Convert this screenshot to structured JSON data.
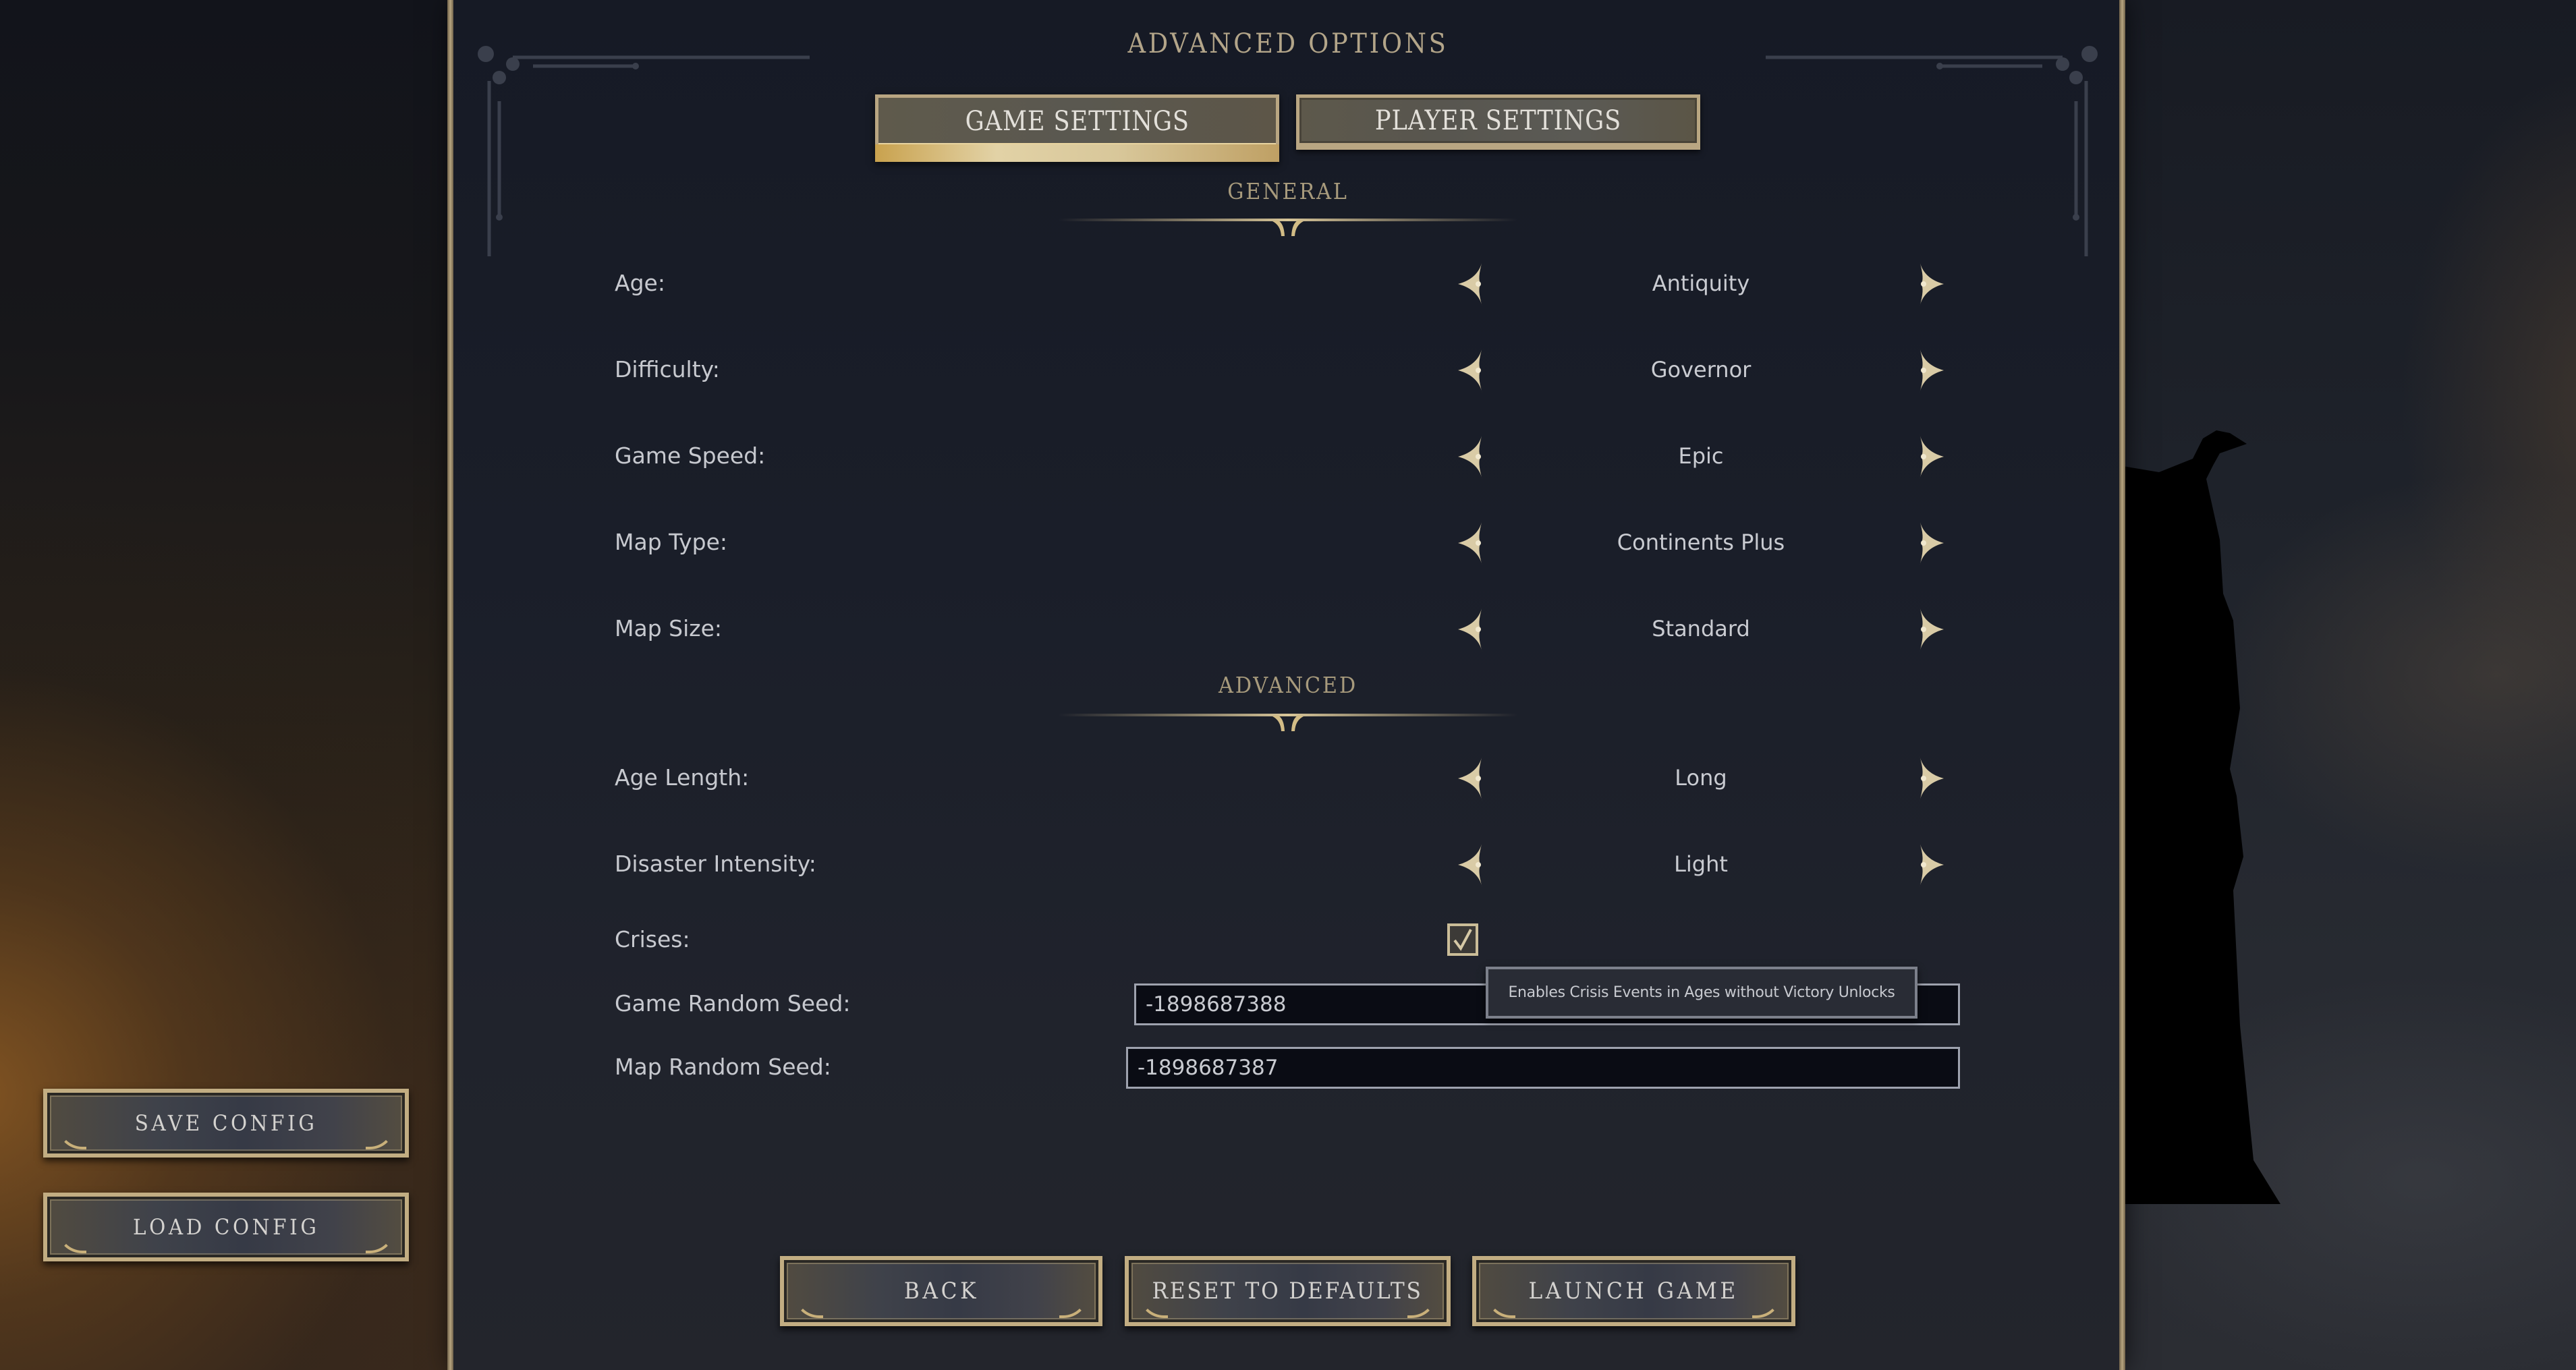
{
  "screen": {
    "title": "ADVANCED OPTIONS"
  },
  "tabs": [
    {
      "label": "GAME SETTINGS",
      "active": true
    },
    {
      "label": "PLAYER SETTINGS",
      "active": false
    }
  ],
  "sections": {
    "general": {
      "title": "GENERAL",
      "rows": [
        {
          "label": "Age:",
          "value": "Antiquity"
        },
        {
          "label": "Difficulty:",
          "value": "Governor"
        },
        {
          "label": "Game Speed:",
          "value": "Epic"
        },
        {
          "label": "Map Type:",
          "value": "Continents Plus"
        },
        {
          "label": "Map Size:",
          "value": "Standard"
        }
      ]
    },
    "advanced": {
      "title": "ADVANCED",
      "rows": [
        {
          "label": "Age Length:",
          "value": "Long"
        },
        {
          "label": "Disaster Intensity:",
          "value": "Light"
        }
      ],
      "crises": {
        "label": "Crises:",
        "checked": true
      },
      "game_seed": {
        "label": "Game Random Seed:",
        "value": "-1898687388"
      },
      "map_seed": {
        "label": "Map Random Seed:",
        "value": "-1898687387"
      }
    }
  },
  "tooltip": {
    "text": "Enables Crisis Events in Ages without Victory Unlocks"
  },
  "side_buttons": {
    "save": "SAVE CONFIG",
    "load": "LOAD CONFIG"
  },
  "footer_buttons": {
    "back": "BACK",
    "reset": "RESET TO DEFAULTS",
    "launch": "LAUNCH GAME"
  },
  "icons": {
    "prev": "chevron-left-ornate-icon",
    "next": "chevron-right-ornate-icon",
    "check": "checkmark-icon"
  },
  "colors": {
    "gold": "#c2ad82",
    "panel": "#1a1e29",
    "title_text": "#b3a589",
    "label_text": "#c7c9cf"
  }
}
